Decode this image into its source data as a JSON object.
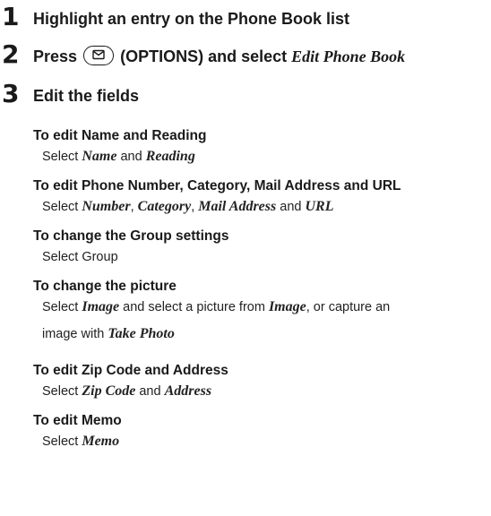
{
  "steps": [
    {
      "number": "1",
      "text": "Highlight an entry on the Phone Book list"
    },
    {
      "number": "2",
      "before": "Press",
      "after": "(OPTIONS) and select",
      "emphasis": "Edit Phone Book",
      "icon": "mail-key-icon"
    },
    {
      "number": "3",
      "text": "Edit the fields"
    }
  ],
  "sections": [
    {
      "heading": "To edit Name and Reading",
      "body": {
        "t0": "Select ",
        "e0": "Name",
        "t1": " and ",
        "e1": "Reading"
      }
    },
    {
      "heading": "To edit Phone Number, Category, Mail Address and URL",
      "body": {
        "t0": "Select ",
        "e0": "Number",
        "t1": ", ",
        "e1": "Category",
        "t2": ", ",
        "e2": "Mail Address",
        "t3": " and ",
        "e3": "URL"
      }
    },
    {
      "heading": "To change the Group settings",
      "body": {
        "t0": "Select Group"
      }
    },
    {
      "heading": "To change the picture",
      "body": {
        "t0": "Select ",
        "e0": "Image",
        "t1": " and select a picture from ",
        "e1": "Image",
        "t2": ", or capture an"
      },
      "body2": {
        "t0": "image with ",
        "e0": "Take Photo"
      }
    },
    {
      "heading": "To edit Zip Code and Address",
      "body": {
        "t0": "Select ",
        "e0": "Zip Code",
        "t1": " and ",
        "e1": "Address"
      }
    },
    {
      "heading": "To edit Memo",
      "body": {
        "t0": "Select ",
        "e0": "Memo"
      }
    }
  ]
}
